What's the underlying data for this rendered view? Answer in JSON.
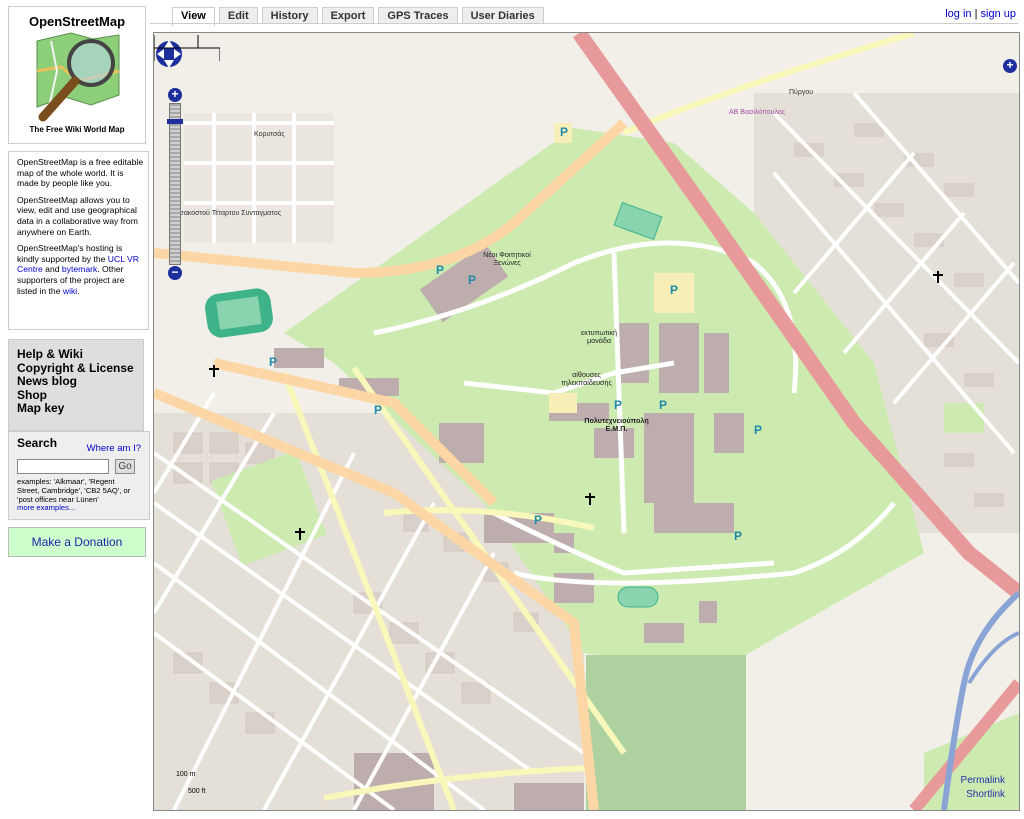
{
  "sidebar": {
    "logo_title": "OpenStreetMap",
    "logo_tagline": "The Free Wiki World Map",
    "intro": {
      "p1": "OpenStreetMap is a free editable map of the whole world. It is made by people like you.",
      "p2": "OpenStreetMap allows you to view, edit and use geographical data in a collaborative way from anywhere on Earth.",
      "p3_before": "OpenStreetMap's hosting is kindly supported by the ",
      "p3_link1": "UCL VR Centre",
      "p3_and": " and ",
      "p3_link2": "bytemark",
      "p3_after": ". Other supporters of the project are listed in the ",
      "p3_link3": "wiki",
      "p3_end": "."
    },
    "nav": [
      "Help & Wiki",
      "Copyright & License",
      "News blog",
      "Shop",
      "Map key"
    ],
    "search": {
      "title": "Search",
      "where_am_i": "Where am I?",
      "go": "Go",
      "examples": "examples: 'Alkmaar', 'Regent Street, Cambridge', 'CB2 5AQ', or 'post offices near Lünen'",
      "more_examples": "more examples..."
    },
    "donate": "Make a Donation"
  },
  "tabs": [
    "View",
    "Edit",
    "History",
    "Export",
    "GPS Traces",
    "User Diaries"
  ],
  "active_tab": "View",
  "auth": {
    "login": "log in",
    "sep": "|",
    "signup": "sign up"
  },
  "map": {
    "labels": {
      "neoi": "Νέοι Φοιτητικοί Ξενώνες",
      "ektipotiki": "εκτυπωτική μονάδα",
      "aithouses": "αίθουσες τηλεκπαίδευσης",
      "polytechnio": "Πολυτεχνειούπολη Ε.Μ.Π.",
      "ab": "ΑΒ Βασιλόπουλος",
      "korytsas": "Κορυτσάς",
      "tsakosto": "Τσακοστού Τέταρτου Συνταγματος",
      "pyrgou": "Πύργου"
    },
    "scale_m": "100 m",
    "scale_ft": "500 ft",
    "permalink": "Permalink",
    "shortlink": "Shortlink",
    "parking": "P",
    "colors": {
      "campus": "#cdebb0",
      "primary": "#f0a6a6",
      "secondary": "#fcd6a4",
      "tertiary": "#f8f8ba",
      "building": "#beadad",
      "water": "#8ba4d6",
      "pitch": "#3eb38a"
    }
  }
}
